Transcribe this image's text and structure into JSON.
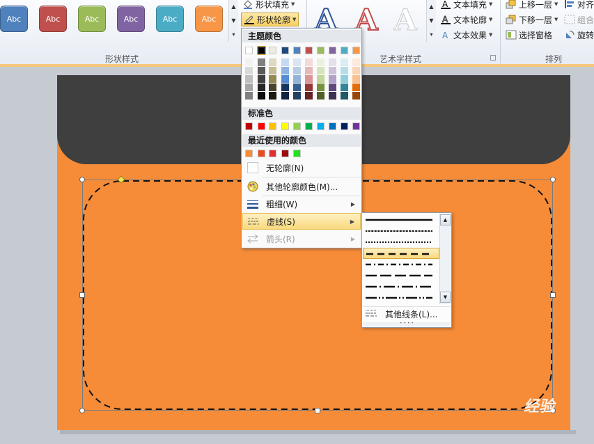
{
  "ribbon": {
    "shape_styles": {
      "label": "形状样式",
      "buttons": [
        {
          "text": "Abc",
          "color": "#4f81bd"
        },
        {
          "text": "Abc",
          "color": "#c0504d"
        },
        {
          "text": "Abc",
          "color": "#9bbb59"
        },
        {
          "text": "Abc",
          "color": "#8064a2"
        },
        {
          "text": "Abc",
          "color": "#4bacc6"
        },
        {
          "text": "Abc",
          "color": "#f79646"
        }
      ]
    },
    "shape_fill": "形状填充",
    "shape_outline": "形状轮廓",
    "wordart": {
      "label": "艺术字样式",
      "text_fill": "文本填充",
      "text_outline": "文本轮廓",
      "text_effects": "文本效果"
    },
    "arrange": {
      "label": "排列",
      "bring_forward": "上移一层",
      "send_backward": "下移一层",
      "selection_pane": "选择窗格",
      "align": "对齐",
      "group": "组合",
      "rotate": "旋转"
    }
  },
  "menu": {
    "theme_colors_header": "主题颜色",
    "standard_colors_header": "标准色",
    "recent_colors_header": "最近使用的颜色",
    "theme_top_row": [
      "#ffffff",
      "#000000",
      "#eeece1",
      "#1f497d",
      "#4f81bd",
      "#c0504d",
      "#9bbb59",
      "#8064a2",
      "#4bacc6",
      "#f79646"
    ],
    "theme_shades": [
      [
        "#f2f2f2",
        "#d9d9d9",
        "#bfbfbf",
        "#a6a6a6",
        "#808080"
      ],
      [
        "#7f7f7f",
        "#595959",
        "#404040",
        "#262626",
        "#0d0d0d"
      ],
      [
        "#ddd9c3",
        "#c4bd97",
        "#938953",
        "#494429",
        "#1d1b10"
      ],
      [
        "#c6d9f0",
        "#8db3e2",
        "#548dd4",
        "#17365d",
        "#0f243e"
      ],
      [
        "#dbe5f1",
        "#b8cce4",
        "#95b3d7",
        "#366092",
        "#244061"
      ],
      [
        "#f2dcdb",
        "#e5b9b7",
        "#d99694",
        "#953734",
        "#632423"
      ],
      [
        "#ebf1dd",
        "#d7e3bc",
        "#c3d69b",
        "#76923c",
        "#4f6128"
      ],
      [
        "#e5e0ec",
        "#ccc1d9",
        "#b2a2c7",
        "#5f497a",
        "#3f3151"
      ],
      [
        "#dbeef3",
        "#b7dde8",
        "#92cddc",
        "#31859b",
        "#205867"
      ],
      [
        "#fdeada",
        "#fbd5b5",
        "#fac08f",
        "#e36c09",
        "#974806"
      ]
    ],
    "standard_colors": [
      "#c00000",
      "#ff0000",
      "#ffc000",
      "#ffff00",
      "#92d050",
      "#00b050",
      "#00b0f0",
      "#0070c0",
      "#002060",
      "#7030a0"
    ],
    "recent_colors": [
      "#f68c38",
      "#e84c22",
      "#e03030",
      "#9b0d0d",
      "#22e022"
    ],
    "no_outline": "无轮廓(N)",
    "more_outline_colors": "其他轮廓颜色(M)...",
    "weight": "粗细(W)",
    "dashes": "虚线(S)",
    "arrows": "箭头(R)"
  },
  "dash_menu": {
    "options": [
      "solid",
      "round-dot",
      "square-dot",
      "dash",
      "dash-dot",
      "long-dash",
      "long-dash-dot",
      "long-dash-dot-dot"
    ],
    "selected": "dash",
    "more_lines": "其他线条(L)..."
  },
  "slide": {
    "background_color": "#f68c38",
    "header_color": "#3f3f3f",
    "watermark": "经验"
  }
}
